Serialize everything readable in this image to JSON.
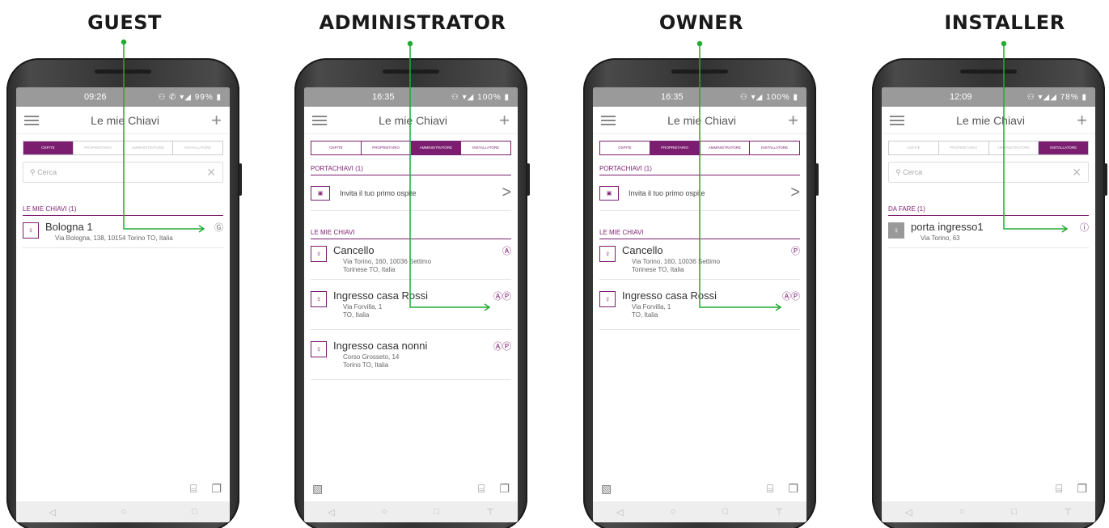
{
  "roles": [
    "GUEST",
    "ADMINISTRATOR",
    "OWNER",
    "INSTALLER"
  ],
  "colors": {
    "accent": "#7b1e6f",
    "connector": "#22aa33"
  },
  "app": {
    "title": "Le mie Chiavi",
    "tabs": [
      "OSPITE",
      "PROPRIETARIO",
      "AMMINISTRATORE",
      "INSTALLATORE"
    ],
    "search_placeholder": "Cerca"
  },
  "screens": {
    "guest": {
      "time": "09:26",
      "status_icons": "⚇ ✆ ▾◢ 99% ▮",
      "active_tab": 0,
      "section": "LE MIE CHIAVI (1)",
      "items": [
        {
          "name": "Bologna 1",
          "addr": "Via Bologna, 138, 10154 Torino TO, Italia",
          "badge": "Ⓖ"
        }
      ]
    },
    "admin": {
      "time": "16:35",
      "status_icons": "⚇ ▾◢ 100% ▮",
      "active_tab": 2,
      "keyring": "PORTACHIAVI (1)",
      "invite": "Invita il tuo primo ospite",
      "section": "LE MIE CHIAVI",
      "items": [
        {
          "name": "Cancello",
          "addr1": "Via Torino, 160, 10036 Settimo",
          "addr2": "Torinese TO, Italia",
          "badge": "Ⓐ"
        },
        {
          "name": "Ingresso casa Rossi",
          "addr1": "Via Forvilla, 1",
          "addr2": "TO, Italia",
          "badge": "ⒶⓅ"
        },
        {
          "name": "Ingresso casa nonni",
          "addr1": "Corso Grosseto, 14",
          "addr2": "Torino TO, Italia",
          "badge": "ⒶⓅ"
        }
      ]
    },
    "owner": {
      "time": "16:35",
      "status_icons": "⚇ ▾◢ 100% ▮",
      "active_tab": 1,
      "keyring": "PORTACHIAVI (1)",
      "invite": "Invita il tuo primo ospite",
      "section": "LE MIE CHIAVI",
      "items": [
        {
          "name": "Cancello",
          "addr1": "Via Torino, 160, 10036 Settimo",
          "addr2": "Torinese TO, Italia",
          "badge": "Ⓟ"
        },
        {
          "name": "Ingresso casa Rossi",
          "addr1": "Via Forvilla, 1",
          "addr2": "TO, Italia",
          "badge": "ⒶⓅ"
        }
      ]
    },
    "installer": {
      "time": "12:09",
      "status_icons": "⚇ ▾◢◢ 78% ▮",
      "active_tab": 3,
      "section": "DA FARE (1)",
      "items": [
        {
          "name": "porta ingresso1",
          "addr": "Via Torino, 63",
          "badge": "ⓘ"
        }
      ]
    }
  }
}
